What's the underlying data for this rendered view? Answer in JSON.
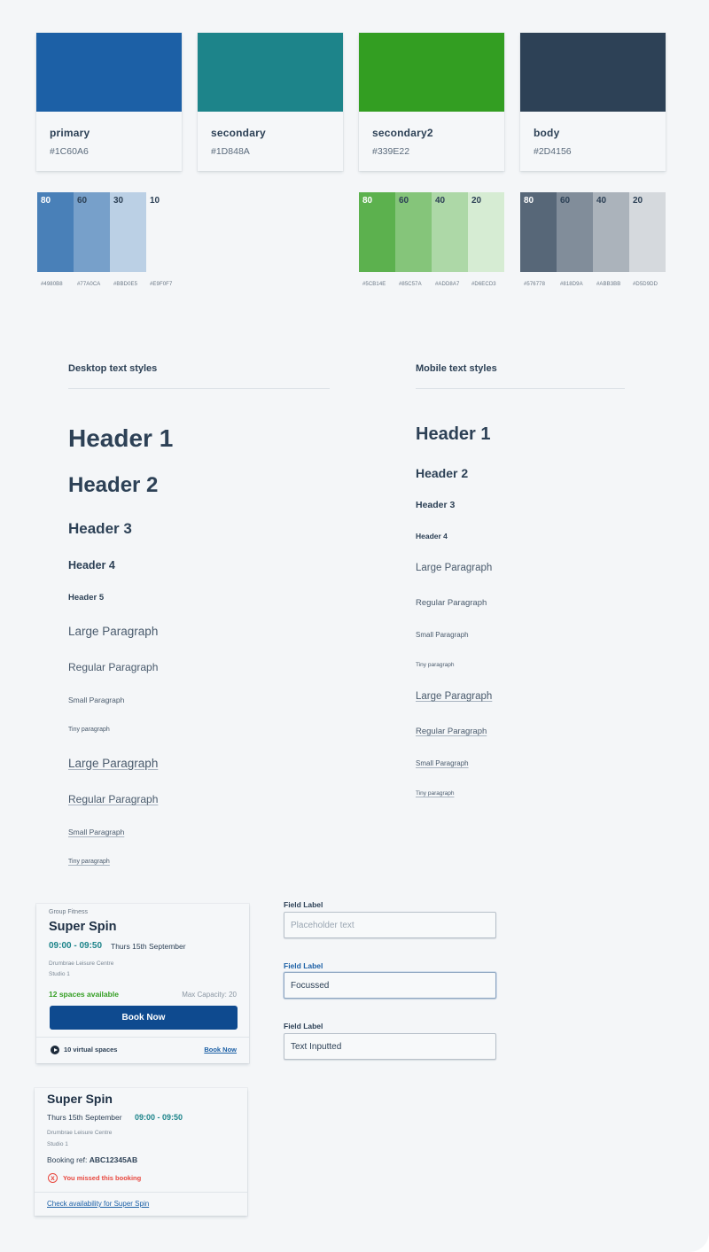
{
  "palette": [
    {
      "name": "primary",
      "hex": "#1C60A6",
      "display": "#1C60A6"
    },
    {
      "name": "secondary",
      "hex": "#1D848A",
      "display": "#1D848A"
    },
    {
      "name": "secondary2",
      "hex": "#339E22",
      "display": "#339E22"
    },
    {
      "name": "body",
      "hex": "#2D4156",
      "display": "#2D4156"
    }
  ],
  "tints": {
    "primary": [
      {
        "pct": "80",
        "hex": "#4980B8",
        "label": "#4980B8",
        "text_color": "#ffffff"
      },
      {
        "pct": "60",
        "hex": "#77A0CA",
        "label": "#77A0CA",
        "text_color": "#2D4156"
      },
      {
        "pct": "30",
        "hex": "#BBD0E5",
        "label": "#BBD0E5",
        "text_color": "#2D4156"
      },
      {
        "pct": "10",
        "hex": "#E9F0F7",
        "label": "#E9F0F7",
        "text_color": "#2D4156"
      }
    ],
    "secondary2": [
      {
        "pct": "80",
        "hex": "#5CB14E",
        "label": "#5CB14E",
        "text_color": "#ffffff"
      },
      {
        "pct": "60",
        "hex": "#85C57A",
        "label": "#85C57A",
        "text_color": "#2D4156"
      },
      {
        "pct": "40",
        "hex": "#ADD8A7",
        "label": "#ADD8A7",
        "text_color": "#2D4156"
      },
      {
        "pct": "20",
        "hex": "#D6ECD3",
        "label": "#D6ECD3",
        "text_color": "#2D4156"
      }
    ],
    "body": [
      {
        "pct": "80",
        "hex": "#576778",
        "label": "#576778",
        "text_color": "#ffffff"
      },
      {
        "pct": "60",
        "hex": "#818D9A",
        "label": "#818D9A",
        "text_color": "#2D4156"
      },
      {
        "pct": "40",
        "hex": "#ABB3BB",
        "label": "#ABB3BB",
        "text_color": "#2D4156"
      },
      {
        "pct": "20",
        "hex": "#D5D9DD",
        "label": "#D5D9DD",
        "text_color": "#2D4156"
      }
    ]
  },
  "desktop_text_styles": {
    "title": "Desktop text styles",
    "items": [
      "Header 1",
      "Header 2",
      "Header 3",
      "Header 4",
      "Header 5",
      "Large Paragraph",
      "Regular Paragraph",
      "Small Paragraph",
      "Tiny paragraph",
      "Large Paragraph",
      "Regular Paragraph",
      "Small Paragraph",
      "Tiny paragraph"
    ]
  },
  "mobile_text_styles": {
    "title": "Mobile text styles",
    "items": [
      "Header 1",
      "Header 2",
      "Header 3",
      "Header 4",
      "Large Paragraph",
      "Regular Paragraph",
      "Small Paragraph",
      "Tiny paragraph",
      "Large Paragraph",
      "Regular Paragraph",
      "Small Paragraph",
      "Tiny paragraph"
    ]
  },
  "class_card": {
    "category": "Group Fitness",
    "title": "Super Spin",
    "time": "09:00 - 09:50",
    "date": "Thurs 15th September",
    "venue": "Drumbrae Leisure Centre",
    "room": "Studio 1",
    "availability": "12 spaces available",
    "capacity": "Max Capacity: 20",
    "book_button": "Book Now",
    "virtual_spaces": "10 virtual spaces",
    "virtual_book_link": "Book Now"
  },
  "booking_card": {
    "title": "Super Spin",
    "date": "Thurs 15th September",
    "time": "09:00 - 09:50",
    "venue": "Drumbrae Leisure Centre",
    "room": "Studio 1",
    "ref_label": "Booking ref:",
    "ref_value": "ABC12345AB",
    "status": "You missed this booking",
    "status_icon": "x",
    "availability_link": "Check availability for Super Spin"
  },
  "form_fields": [
    {
      "label": "Field Label",
      "placeholder": "Placeholder text",
      "value": ""
    },
    {
      "label": "Field Label",
      "placeholder": "",
      "value": "Focussed"
    },
    {
      "label": "Field Label",
      "placeholder": "",
      "value": "Text Inputted"
    }
  ],
  "colors": {
    "secondary_text": "#1D848A",
    "success_text": "#339E22",
    "error_text": "#E8473E",
    "button_bg": "#0E4A8F",
    "link": "#1C60A6"
  }
}
